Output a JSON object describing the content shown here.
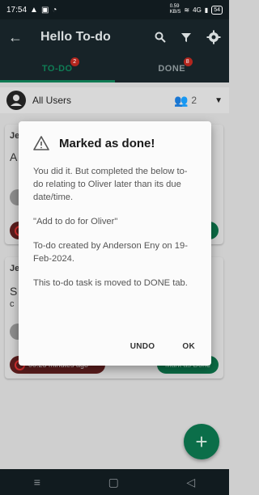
{
  "status": {
    "time": "17:54",
    "speed_value": "0.59",
    "speed_unit": "KB/S",
    "net": "4G",
    "battery": "54"
  },
  "app": {
    "title": "Hello To-do"
  },
  "tabs": [
    {
      "label": "TO-DO",
      "badge": "2"
    },
    {
      "label": "DONE",
      "badge": "8"
    }
  ],
  "user_filter": {
    "name": "All Users",
    "count": "2"
  },
  "cards": [
    {
      "initial": "Je",
      "letter": "A"
    },
    {
      "initial": "Je",
      "letter": "S",
      "letter2": "c",
      "timer": "00:25 minutes ago",
      "action": "Mark as Done"
    }
  ],
  "dialog": {
    "title": "Marked as done!",
    "paragraphs": [
      "You did it. But completed the below to-do relating to Oliver later than its due date/time.",
      "\"Add to do for Oliver\"",
      "To-do created by Anderson Eny on 19-Feb-2024.",
      "This to-do task is moved to DONE tab."
    ],
    "undo_label": "UNDO",
    "ok_label": "OK"
  }
}
